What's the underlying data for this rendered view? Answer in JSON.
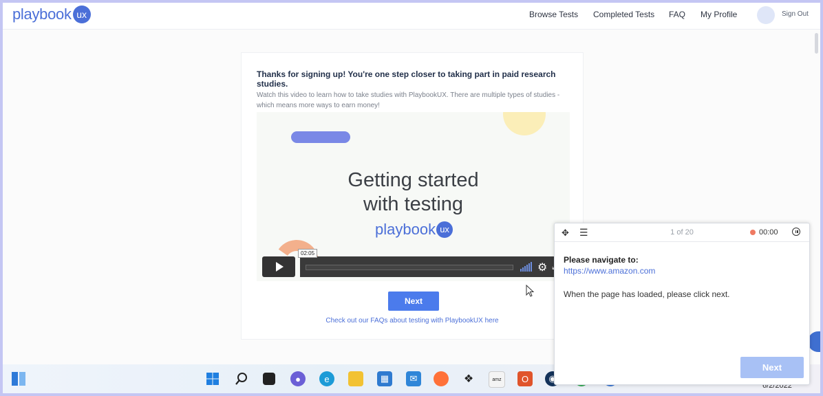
{
  "header": {
    "logo_text": "playbook",
    "logo_badge": "ux",
    "nav": [
      "Browse Tests",
      "Completed Tests",
      "FAQ",
      "My Profile"
    ],
    "sign_out": "Sign Out"
  },
  "card": {
    "heading": "Thanks for signing up! You're one step closer to taking part in paid research studies.",
    "subtext": "Watch this video to learn how to take studies with PlaybookUX. There are multiple types of studies - which means more ways to earn money!",
    "video": {
      "title_line1": "Getting started",
      "title_line2": "with testing",
      "logo_text": "playbook",
      "logo_badge": "ux",
      "time_tooltip": "02:05"
    },
    "next_label": "Next",
    "faq_link": "Check out our FAQs about testing with PlaybookUX here"
  },
  "panel": {
    "counter": "1 of 20",
    "timer": "00:00",
    "label": "Please navigate to:",
    "url": "https://www.amazon.com",
    "message": "When the page has loaded, please click next.",
    "next_label": "Next"
  },
  "taskbar": {
    "icons": [
      "widgets-icon",
      "start-icon",
      "search-icon",
      "task-view-icon",
      "chat-icon",
      "edge-icon",
      "file-explorer-icon",
      "store-icon",
      "mail-icon",
      "firefox-icon",
      "dropbox-icon",
      "amazon-icon",
      "office-icon",
      "steam-icon",
      "chrome-icon",
      "globe-icon"
    ],
    "date": "6/2/2022"
  },
  "colors": {
    "accent": "#4b7bec",
    "brand": "#4b6fd8",
    "record": "#ef7a62"
  }
}
